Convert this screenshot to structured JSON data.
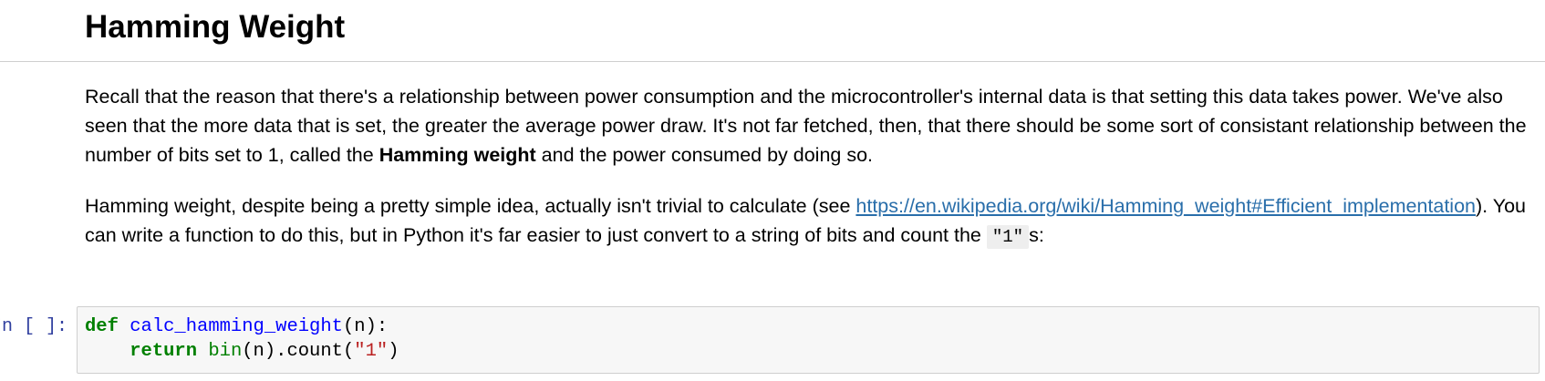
{
  "heading": {
    "title": "Hamming Weight"
  },
  "paragraph1": {
    "text_before": "Recall that the reason that there's a relationship between power consumption and the microcontroller's internal data is that setting this data takes power. We've also seen that the more data that is set, the greater the average power draw. It's not far fetched, then, that there should be some sort of consistant relationship between the number of bits set to 1, called the ",
    "bold": "Hamming weight",
    "text_after": " and the power consumed by doing so."
  },
  "paragraph2": {
    "text_before": "Hamming weight, despite being a pretty simple idea, actually isn't trivial to calculate (see ",
    "link_text": "https://en.wikipedia.org/wiki/Hamming_weight#Efficient_implementation",
    "text_middle": "). You can write a function to do this, but in Python it's far easier to just convert to a string of bits and count the ",
    "inline_code": "\"1\"",
    "text_after": "s:"
  },
  "code_cell": {
    "prompt": "In [ ]:",
    "line1": {
      "keyword": "def",
      "space": " ",
      "function_name": "calc_hamming_weight",
      "rest": "(n):"
    },
    "line2": {
      "indent": "    ",
      "keyword": "return",
      "space": " ",
      "builtin": "bin",
      "middle": "(n).count(",
      "string": "\"1\"",
      "end": ")"
    }
  },
  "colors": {
    "link": "#296eaa",
    "prompt": "#303f9f",
    "keyword": "#008000",
    "function": "#0000ff",
    "string": "#ba2121",
    "code_background": "#f7f7f7"
  }
}
